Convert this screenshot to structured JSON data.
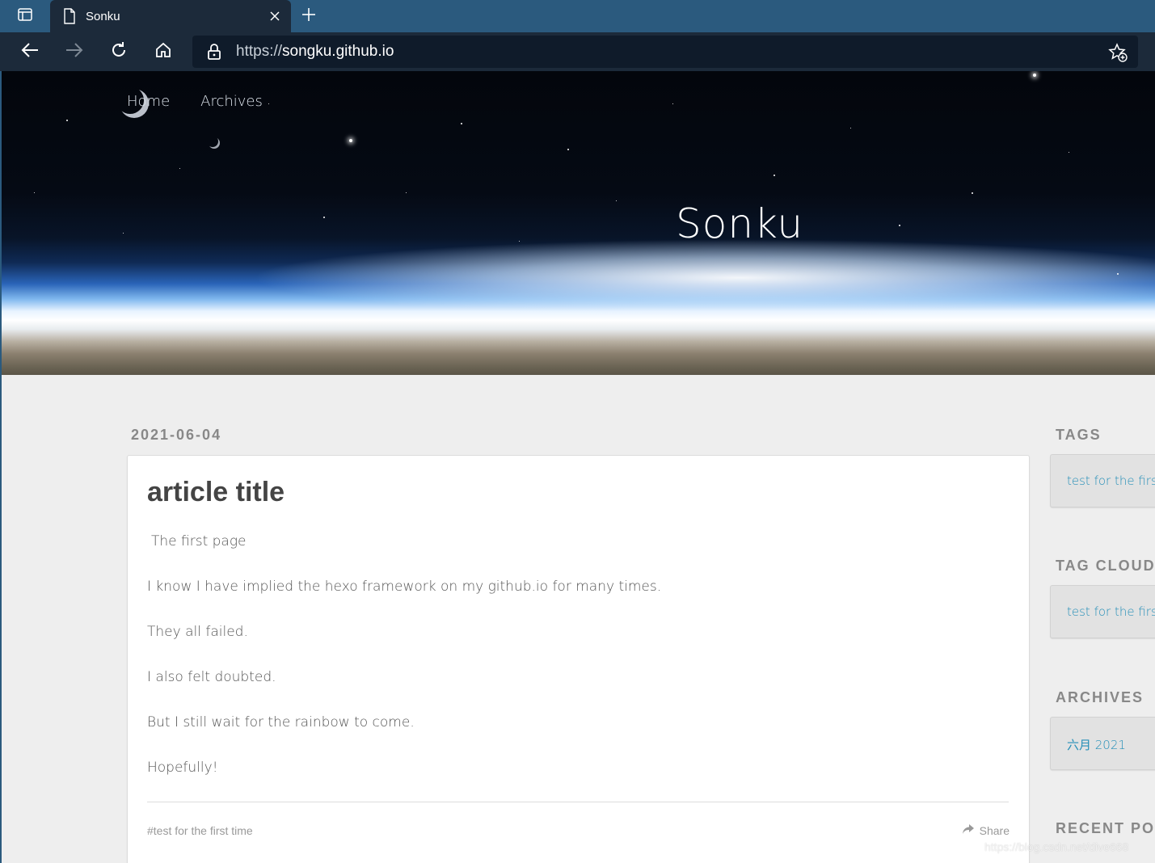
{
  "browser": {
    "tab_title": "Sonku",
    "url_protocol": "https://",
    "url_host": "songku.github.io"
  },
  "site": {
    "title": "Sonku",
    "nav": [
      {
        "label": "Home"
      },
      {
        "label": "Archives"
      }
    ]
  },
  "post": {
    "date": "2021-06-04",
    "title": "article title",
    "paragraphs": [
      "The first page",
      "I know I have implied the hexo framework on my github.io for many times.",
      "They all failed.",
      "I also felt doubted.",
      "But I still wait for the rainbow to come.",
      "Hopefully!"
    ],
    "tag": "#test for the first time",
    "share_label": "Share"
  },
  "sidebar": {
    "tags": {
      "title": "TAGS",
      "item": "test for the first time"
    },
    "tag_cloud": {
      "title": "TAG CLOUD",
      "item": "test for the first time"
    },
    "archives": {
      "title": "ARCHIVES",
      "item": "六月 2021"
    },
    "recent_posts": {
      "title": "RECENT POSTS"
    }
  },
  "watermark": "https://blog.csdn.net/dive668",
  "colors": {
    "tabbar": "#2b5a7e",
    "toolbar": "#1c2a3a",
    "page_bg": "#eeeeee",
    "link": "#258fb8"
  }
}
